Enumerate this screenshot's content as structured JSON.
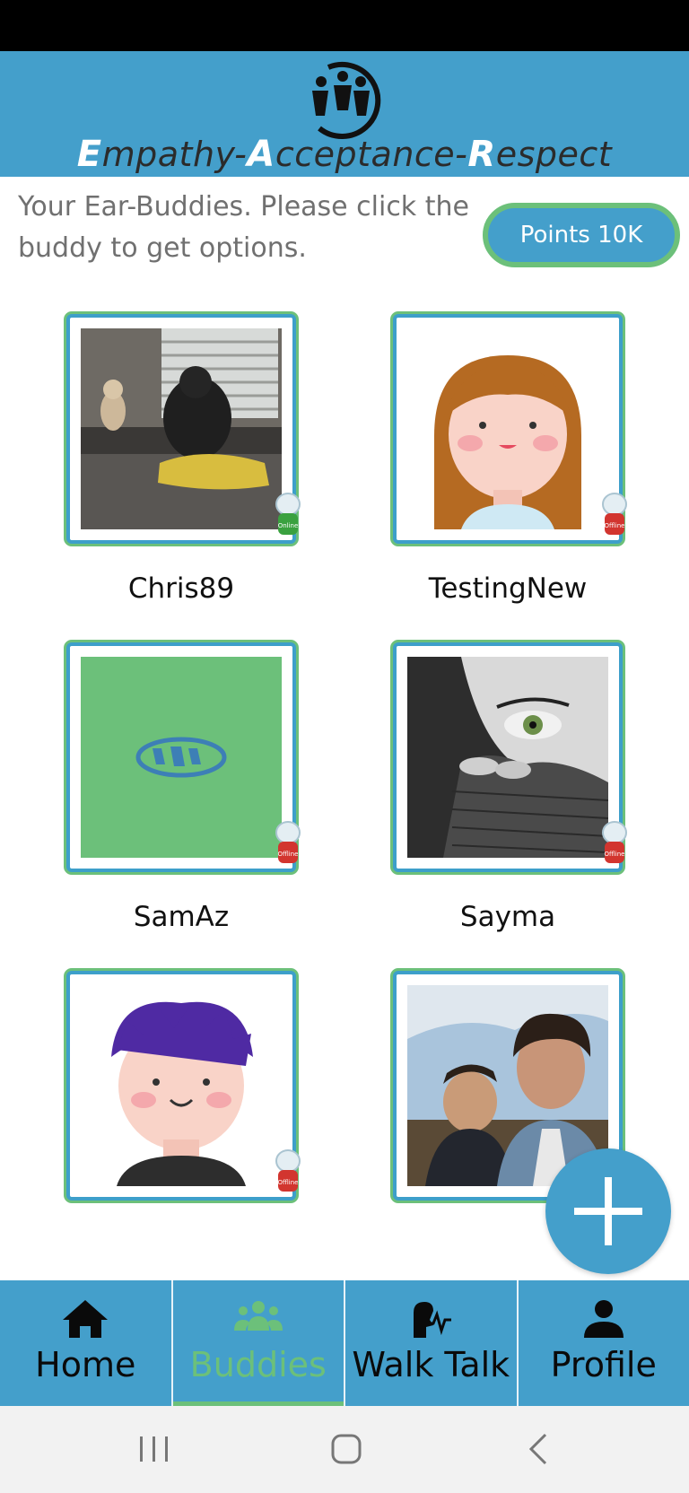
{
  "header": {
    "tagline": {
      "w1_cap": "E",
      "w1_rest": "mpathy-",
      "w2_cap": "A",
      "w2_rest": "cceptance-",
      "w3_cap": "R",
      "w3_rest": "espect"
    }
  },
  "intro_text": "Your Ear-Buddies. Please click the buddy to get options.",
  "points_label": "Points 10K",
  "buddies": [
    {
      "name": "Chris89",
      "status": "Online"
    },
    {
      "name": "TestingNew",
      "status": "Offline"
    },
    {
      "name": "SamAz",
      "status": "Offline"
    },
    {
      "name": "Sayma",
      "status": "Offline"
    },
    {
      "name": "",
      "status": "Offline"
    },
    {
      "name": "",
      "status": ""
    }
  ],
  "nav": {
    "items": [
      {
        "label": "Home",
        "icon": "home-icon"
      },
      {
        "label": "Buddies",
        "icon": "buddies-icon",
        "active": true
      },
      {
        "label": "Walk Talk",
        "icon": "walk-talk-icon"
      },
      {
        "label": "Profile",
        "icon": "profile-icon"
      }
    ]
  },
  "colors": {
    "primary": "#449fcb",
    "accent": "#6cc07a"
  }
}
